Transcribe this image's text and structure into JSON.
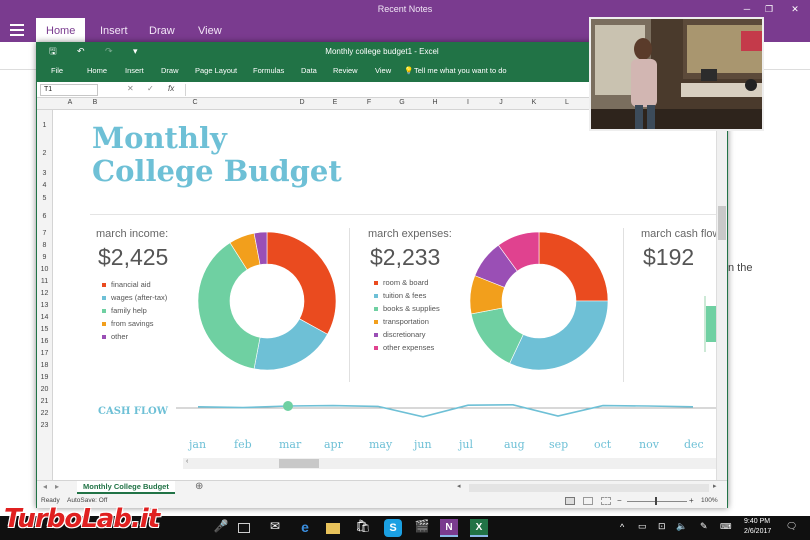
{
  "onenote": {
    "window_title": "Recent Notes",
    "tabs": [
      "Home",
      "Insert",
      "Draw",
      "View"
    ],
    "active_tab": "Home",
    "page_snippet": "n the"
  },
  "excel": {
    "window_title": "Monthly college budget1 - Excel",
    "menu": [
      "File",
      "Home",
      "Insert",
      "Draw",
      "Page Layout",
      "Formulas",
      "Data",
      "Review",
      "View"
    ],
    "tell_me": "Tell me what you want to do",
    "name_box": "T1",
    "columns": [
      "A",
      "B",
      "C",
      "D",
      "E",
      "F",
      "G",
      "H",
      "I",
      "J",
      "K",
      "L"
    ],
    "rows": [
      "1",
      "2",
      "3",
      "4",
      "5",
      "6",
      "7",
      "8",
      "9",
      "10",
      "11",
      "12",
      "13",
      "14",
      "15",
      "16",
      "17",
      "18",
      "19",
      "20",
      "21",
      "22",
      "23"
    ],
    "sheet_tab": "Monthly College Budget",
    "status_ready": "Ready",
    "status_autosave": "AutoSave: Off",
    "zoom": "100%"
  },
  "budget": {
    "title_line1": "Monthly",
    "title_line2": "College Budget",
    "income": {
      "label": "march income:",
      "amount": "$2,425",
      "legend": [
        "financial aid",
        "wages (after-tax)",
        "family help",
        "from savings",
        "other"
      ],
      "legend_colors": [
        "#ea4b1f",
        "#6ec0d6",
        "#6fd0a2",
        "#f29f1c",
        "#9a4fb5"
      ],
      "slices": [
        33,
        20,
        38,
        6,
        3
      ]
    },
    "expenses": {
      "label": "march expenses:",
      "amount": "$2,233",
      "legend": [
        "room & board",
        "tuition & fees",
        "books & supplies",
        "transportation",
        "discretionary",
        "other expenses"
      ],
      "legend_colors": [
        "#ea4b1f",
        "#6ec0d6",
        "#6fd0a2",
        "#f29f1c",
        "#9a4fb5",
        "#e0428f"
      ],
      "slices": [
        25,
        32,
        15,
        9,
        9,
        10
      ]
    },
    "cash": {
      "label": "march cash flow",
      "amount": "$192"
    },
    "cashflow": {
      "label": "CASH FLOW",
      "months": [
        "jan",
        "feb",
        "mar",
        "apr",
        "may",
        "jun",
        "jul",
        "aug",
        "sep",
        "oct",
        "nov",
        "dec"
      ],
      "values": [
        0.3,
        0.1,
        0.5,
        0.6,
        0.4,
        -2.2,
        0.7,
        0.8,
        -2.0,
        0.6,
        0.5,
        0.3
      ]
    }
  },
  "taskbar": {
    "time": "9:40 PM",
    "date": "2/6/2017"
  },
  "watermark": "TurboLab.it"
}
